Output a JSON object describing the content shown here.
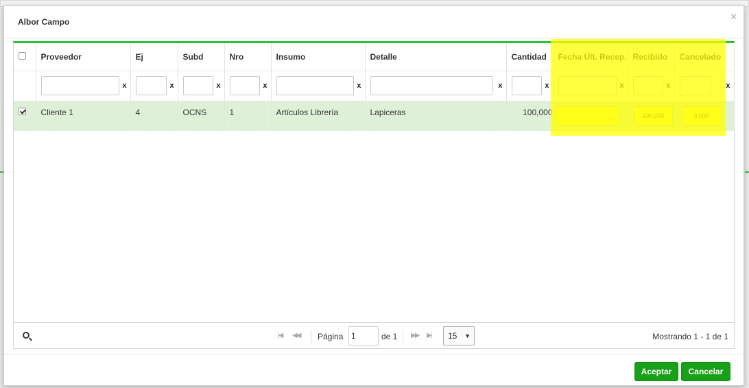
{
  "dialog": {
    "title": "Albor Campo",
    "close_glyph": "×"
  },
  "grid": {
    "columns": [
      "Proveedor",
      "Ej",
      "Subd",
      "Nro",
      "Insumo",
      "Detalle",
      "Cantidad",
      "Fecha Últ. Recep.",
      "Recibido",
      "Cancelado"
    ],
    "filter_clear": "x",
    "rows": [
      {
        "selected": true,
        "proveedor": "Cliente 1",
        "ej": "4",
        "subd": "OCNS",
        "nro": "1",
        "insumo": "Artículos Librería",
        "detalle": "Lapiceras",
        "cantidad": "100,000",
        "fecha": "",
        "date_button": "...",
        "recibido": "100,000",
        "cancelado": "0,000"
      }
    ]
  },
  "pager": {
    "page_label": "Página",
    "page_value": "1",
    "of_label": "de 1",
    "page_size": "15",
    "info": "Mostrando 1 - 1 de 1"
  },
  "buttons": {
    "accept": "Aceptar",
    "cancel": "Cancelar"
  },
  "colors": {
    "accent": "#18a018",
    "row_selected": "#dff0d8",
    "highlight": "#ffff00",
    "editable": "#ffff66"
  },
  "icons": [
    "close-icon",
    "search-icon",
    "first-page-icon",
    "prev-page-icon",
    "next-page-icon",
    "last-page-icon",
    "chevron-down-icon"
  ]
}
